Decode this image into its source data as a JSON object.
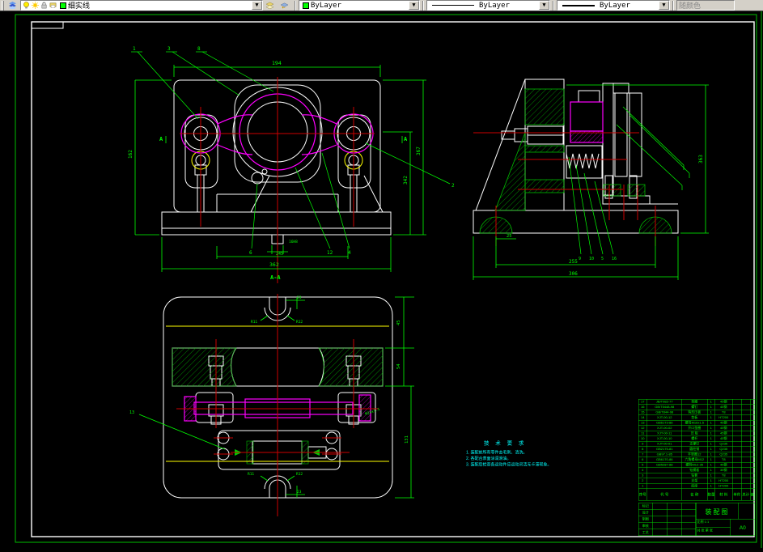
{
  "toolbar": {
    "layers_button": "layers",
    "layer_combo": {
      "value": "细实线"
    },
    "color_combo": {
      "value": "ByLayer",
      "chip_color": "#00ff00"
    },
    "linetype_combo": {
      "value": "ByLayer"
    },
    "lineweight_combo": {
      "value": "ByLayer"
    },
    "plotstyle_combo": {
      "value": "随颜色"
    }
  },
  "colors": {
    "sheet_border": "#00cc00",
    "frame": "#ffffff",
    "dims": "#00ff00",
    "outline": "#ffffff",
    "accent": "#ff00ff",
    "centerline": "#cc0000",
    "aux": "#ffff00",
    "notes": "#00ffff"
  },
  "drawing": {
    "front_view": {
      "dim_top": "194",
      "dim_bottom": "362",
      "dim_inner_bottom": "245",
      "dim_right_outer": "367",
      "dim_right_inner": "342",
      "dim_left": "162",
      "dim_notch": "16H8",
      "section_label": "A-A",
      "section_letter": "A",
      "leader_1": "1",
      "leader_3": "3",
      "leader_8": "8",
      "leader_6": "6",
      "leader_12": "12",
      "leader_4": "4",
      "leader_2": "2"
    },
    "side_view": {
      "dim_foot": "25",
      "dim_inner": "255",
      "dim_overall": "306",
      "dim_height": "363",
      "leader_9": "9",
      "leader_10": "10",
      "leader_5": "5",
      "leader_16": "16"
    },
    "plan_view": {
      "dim_top_seg": "45",
      "dim_bar": "54",
      "dim_lower": "131",
      "dim_23_top": "23",
      "dim_23_bottom": "23",
      "r_top_left": "R11",
      "r_top_right": "R12",
      "r_bottom_left": "R11",
      "r_bottom_right": "R12",
      "thread_label": "M24x1.5",
      "leader_13": "13"
    },
    "tech_req": {
      "title": "技 术 要 求",
      "items": [
        "1. 装配前所有零件去毛刺、清洗。",
        "2. 各配合表面涂润滑油。",
        "3. 装配后检查各运动件应运动灵活无卡滞现象。"
      ]
    }
  },
  "bom": {
    "headers": {
      "no": "序号",
      "code": "代  号",
      "name": "名  称",
      "qty": "数量",
      "material": "材 料",
      "w1": "单件",
      "w2": "总计",
      "weight": "重量",
      "remark": "备注"
    },
    "rows": [
      {
        "no": "17",
        "code": "JB/T982-77",
        "name": "垫圈",
        "qty": "1",
        "material": "45钢",
        "w1": "",
        "w2": "",
        "remark": ""
      },
      {
        "no": "16",
        "code": "GB/T5448-98",
        "name": "螺钉",
        "qty": "1",
        "material": "45钢",
        "w1": "",
        "w2": "",
        "remark": ""
      },
      {
        "no": "15",
        "code": "GB/T844-98",
        "name": "钩形压板",
        "qty": "1",
        "material": "T8",
        "w1": "",
        "w2": "",
        "remark": ""
      },
      {
        "no": "14",
        "code": "XJT-00-12",
        "name": "垫板",
        "qty": "1",
        "material": "HT200",
        "w1": "",
        "w2": "",
        "remark": ""
      },
      {
        "no": "13",
        "code": "GB6173-86",
        "name": "螺母M16x1.5",
        "qty": "1",
        "material": "45钢",
        "w1": "",
        "w2": "",
        "remark": ""
      },
      {
        "no": "12",
        "code": "XJT-00-02",
        "name": "开口垫圈",
        "qty": "1",
        "material": "45钢",
        "w1": "",
        "w2": "",
        "remark": ""
      },
      {
        "no": "11",
        "code": "XJT-00-11",
        "name": "压  板",
        "qty": "1",
        "material": "45钢",
        "w1": "",
        "w2": "",
        "remark": ""
      },
      {
        "no": "10",
        "code": "XJT-00-10",
        "name": "螺杆",
        "qty": "1",
        "material": "45钢",
        "w1": "",
        "w2": "",
        "remark": ""
      },
      {
        "no": "9",
        "code": "XJT-00-01",
        "name": "支撑钉",
        "qty": "1",
        "material": "Q235",
        "w1": "",
        "w2": "",
        "remark": ""
      },
      {
        "no": "8",
        "code": "GB2175-81",
        "name": "圆柱销",
        "qty": "1",
        "material": "Q235",
        "w1": "",
        "w2": "",
        "remark": ""
      },
      {
        "no": "7",
        "code": "GB97.1-85",
        "name": "平垫圈12",
        "qty": "1",
        "material": "Q235",
        "w1": "",
        "w2": "",
        "remark": ""
      },
      {
        "no": "6",
        "code": "GB6170-86",
        "name": "六角螺母M12",
        "qty": "1",
        "material": "T8",
        "w1": "",
        "w2": "",
        "remark": ""
      },
      {
        "no": "5",
        "code": "GB5287-88",
        "name": "螺栓M12-35",
        "qty": "1",
        "material": "45钢",
        "w1": "",
        "w2": "",
        "remark": ""
      },
      {
        "no": "4",
        "code": "",
        "name": "钻模板",
        "qty": "1",
        "material": "35钢",
        "w1": "",
        "w2": "",
        "remark": ""
      },
      {
        "no": "3",
        "code": "",
        "name": "钻套",
        "qty": "1",
        "material": "T8",
        "w1": "",
        "w2": "",
        "remark": ""
      },
      {
        "no": "2",
        "code": "",
        "name": "支架",
        "qty": "1",
        "material": "HT200",
        "w1": "",
        "w2": "",
        "remark": ""
      },
      {
        "no": "1",
        "code": "",
        "name": "底座",
        "qty": "1",
        "material": "HT200",
        "w1": "",
        "w2": "",
        "remark": ""
      }
    ]
  },
  "titleblock": {
    "title": "装配图",
    "sheet": "A0",
    "info1": "比例 1:1",
    "info2": "共 张 第 张",
    "sig_labels": [
      "标记",
      "设计",
      "制图",
      "审核",
      "工艺"
    ]
  }
}
